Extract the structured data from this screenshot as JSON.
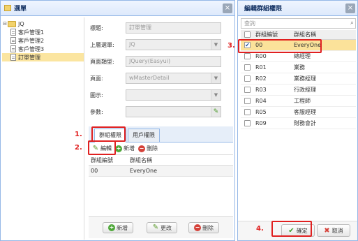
{
  "left_window": {
    "title": "選單",
    "close": "×",
    "tree": {
      "root": "JQ",
      "items": [
        "客戶管理1",
        "客戶管理2",
        "客戶管理3",
        "訂單管理"
      ]
    },
    "form": {
      "fields": [
        {
          "label": "標題:",
          "value": "訂單管理"
        },
        {
          "label": "上層選單:",
          "value": "JQ"
        },
        {
          "label": "頁面類型:",
          "value": "JQuery(Easyui)"
        },
        {
          "label": "頁面:",
          "value": "wMasterDetail"
        },
        {
          "label": "圖示:",
          "value": ""
        },
        {
          "label": "參數:",
          "value": ""
        }
      ]
    },
    "tabs": [
      "群組權限",
      "用戶權限"
    ],
    "toolbar": {
      "edit": "編輯",
      "add": "新增",
      "delete": "刪除"
    },
    "grid": {
      "columns": [
        "群組編號",
        "群組名稱"
      ],
      "rows": [
        [
          "00",
          "EveryOne"
        ]
      ]
    },
    "footer": {
      "add": "新增",
      "update": "更改",
      "delete": "刪除"
    }
  },
  "right_window": {
    "title": "編輯群組權限",
    "close": "×",
    "search_placeholder": "查詢",
    "columns": [
      "群組編號",
      "群組名稱"
    ],
    "rows": [
      {
        "id": "00",
        "name": "EveryOne",
        "checked": true
      },
      {
        "id": "R00",
        "name": "總經理",
        "checked": false
      },
      {
        "id": "R01",
        "name": "業務",
        "checked": false
      },
      {
        "id": "R02",
        "name": "業務經理",
        "checked": false
      },
      {
        "id": "R03",
        "name": "行政經理",
        "checked": false
      },
      {
        "id": "R04",
        "name": "工程師",
        "checked": false
      },
      {
        "id": "R05",
        "name": "客服經理",
        "checked": false
      },
      {
        "id": "R09",
        "name": "財務會計",
        "checked": false
      }
    ],
    "footer": {
      "ok": "確定",
      "cancel": "取消"
    }
  },
  "annotations": {
    "n1": "1.",
    "n2": "2.",
    "n3": "3.",
    "n4": "4."
  },
  "colors": {
    "accent_red": "#e02020",
    "selected_row": "#fbe29a",
    "panel_border": "#95b8e7"
  }
}
